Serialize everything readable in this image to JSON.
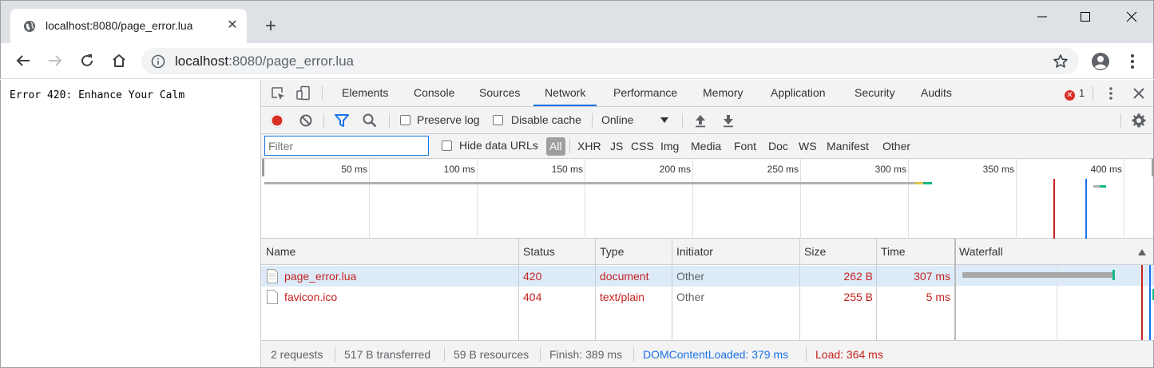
{
  "browser": {
    "tab_title": "localhost:8080/page_error.lua",
    "tab_close": "✕",
    "new_tab": "+",
    "url_host": "localhost",
    "url_rest": ":8080/page_error.lua"
  },
  "page": {
    "text": "Error 420: Enhance Your Calm"
  },
  "devtools": {
    "tabs": [
      "Elements",
      "Console",
      "Sources",
      "Network",
      "Performance",
      "Memory",
      "Application",
      "Security",
      "Audits"
    ],
    "active_tab": "Network",
    "error_count": "1",
    "error_icon_glyph": "✕",
    "toolbar": {
      "preserve_log": "Preserve log",
      "disable_cache": "Disable cache",
      "throttle": "Online"
    },
    "filter": {
      "placeholder": "Filter",
      "hide_data_urls": "Hide data URLs",
      "types": [
        "All",
        "XHR",
        "JS",
        "CSS",
        "Img",
        "Media",
        "Font",
        "Doc",
        "WS",
        "Manifest",
        "Other"
      ]
    },
    "overview": {
      "ticks": [
        "50 ms",
        "100 ms",
        "150 ms",
        "200 ms",
        "250 ms",
        "300 ms",
        "350 ms",
        "400 ms"
      ]
    },
    "table": {
      "columns": [
        "Name",
        "Status",
        "Type",
        "Initiator",
        "Size",
        "Time",
        "Waterfall"
      ],
      "rows": [
        {
          "name": "page_error.lua",
          "status": "420",
          "type": "document",
          "initiator": "Other",
          "size": "262 B",
          "time": "307 ms"
        },
        {
          "name": "favicon.ico",
          "status": "404",
          "type": "text/plain",
          "initiator": "Other",
          "size": "255 B",
          "time": "5 ms"
        }
      ]
    },
    "status": {
      "requests": "2 requests",
      "transferred": "517 B transferred",
      "resources": "59 B resources",
      "finish": "Finish: 389 ms",
      "dom_content_loaded": "DOMContentLoaded: 379 ms",
      "load": "Load: 364 ms"
    },
    "colors": {
      "accent": "#1a73e8",
      "error": "#c5221f",
      "dom_line": "#1a73e8",
      "load_line": "#c5221f",
      "selected_row": "#ddebf9"
    }
  }
}
